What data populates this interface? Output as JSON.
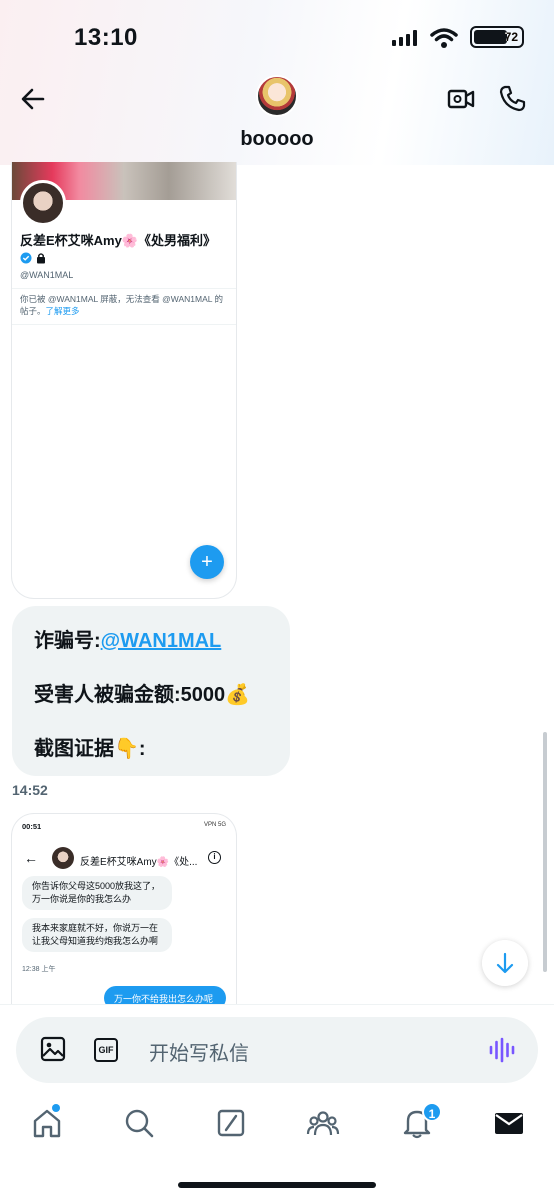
{
  "status_bar": {
    "time": "13:10",
    "battery": "72",
    "battery_level": 0.72
  },
  "header": {
    "contact_name": "booooo"
  },
  "screenshot_1": {
    "profile_name": "反差E杯艾咪Amy🌸《处男福利》",
    "handle": "@WAN1MAL",
    "blocked_text": "你已被 @WAN1MAL 屏蔽，无法查看 @WAN1MAL 的帖子。",
    "learn_more": "了解更多",
    "fab_icon": "+"
  },
  "message": {
    "line1_label": "诈骗号:",
    "line1_link": "@WAN1MAL",
    "line2": "受害人被骗金额:5000💰",
    "line3": "截图证据👇:"
  },
  "timestamp": "14:52",
  "screenshot_2": {
    "status_time": "00:51",
    "status_right": "VPN 5G",
    "chat_name": "反差E杯艾咪Amy🌸《处...",
    "msg1": "你告诉你父母这5000放我这了，万一你说是你的我怎么办",
    "msg2": "我本来家庭就不好，你说万一在让我父母知道我约炮我怎么办啊",
    "time": "12:38 上午",
    "sent": "万一你不给我出怎么办呢"
  },
  "composer": {
    "placeholder": "开始写私信",
    "gif_label": "GIF"
  },
  "tabbar": {
    "notifications_badge": "1"
  },
  "colors": {
    "accent": "#1d9bf0",
    "bubble": "#eff3f4",
    "text": "#0f1419",
    "muted": "#536471",
    "voice": "#7856ff"
  }
}
